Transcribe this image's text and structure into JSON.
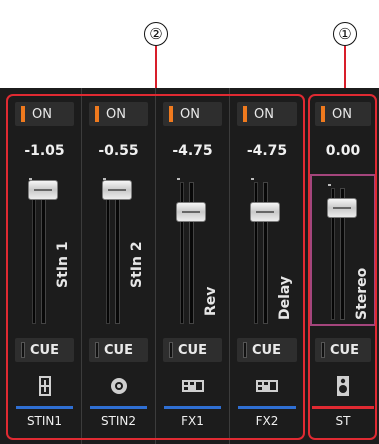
{
  "callouts": {
    "group": "②",
    "stereo": "①"
  },
  "colors": {
    "on_led": "#f07a1e",
    "group_outline": "#e02a32",
    "st_fader_outline": "#a4457c",
    "blue_bar": "#2f6fd3",
    "red_bar": "#e02a32"
  },
  "channels": [
    {
      "name": "STIN1",
      "on_label": "ON",
      "level": "-1.05",
      "fader_label": "StIn 1",
      "cue_label": "CUE",
      "icon": "input-jack-icon",
      "bar_color": "#2f6fd3"
    },
    {
      "name": "STIN2",
      "on_label": "ON",
      "level": "-0.55",
      "fader_label": "StIn 2",
      "cue_label": "CUE",
      "icon": "cd-disc-icon",
      "bar_color": "#2f6fd3"
    },
    {
      "name": "FX1",
      "on_label": "ON",
      "level": "-4.75",
      "fader_label": "Rev",
      "cue_label": "CUE",
      "icon": "effect-unit-icon",
      "bar_color": "#2f6fd3"
    },
    {
      "name": "FX2",
      "on_label": "ON",
      "level": "-4.75",
      "fader_label": "Delay",
      "cue_label": "CUE",
      "icon": "effect-unit-icon",
      "bar_color": "#2f6fd3"
    },
    {
      "name": "ST",
      "on_label": "ON",
      "level": "0.00",
      "fader_label": "Stereo",
      "cue_label": "CUE",
      "icon": "speaker-icon",
      "bar_color": "#e02a32"
    }
  ]
}
